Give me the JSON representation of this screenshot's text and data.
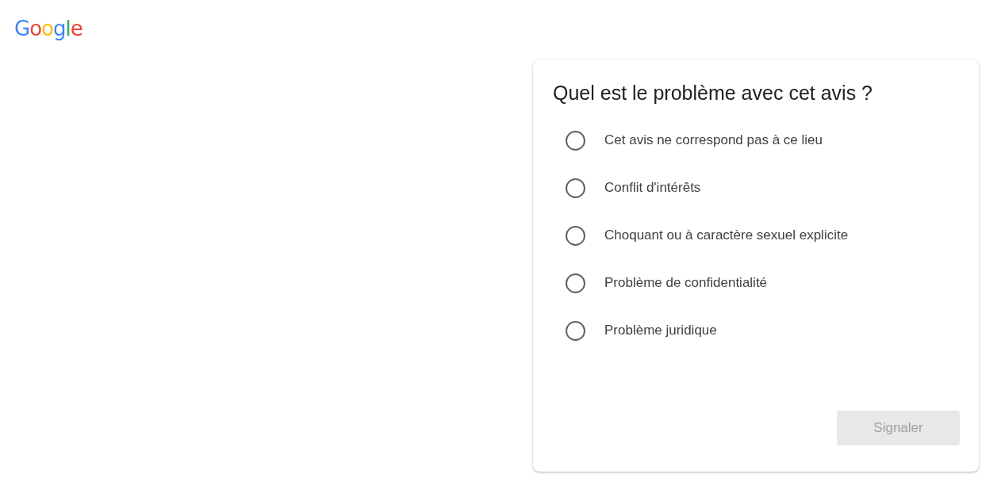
{
  "logo": "Google",
  "dialog": {
    "title": "Quel est le problème avec cet avis ?",
    "options": [
      {
        "label": "Cet avis ne correspond pas à ce lieu",
        "selected": false
      },
      {
        "label": "Conflit d'intérêts",
        "selected": false
      },
      {
        "label": "Choquant ou à caractère sexuel explicite",
        "selected": false
      },
      {
        "label": "Problème de confidentialité",
        "selected": false
      },
      {
        "label": "Problème juridique",
        "selected": false
      }
    ],
    "submit": {
      "label": "Signaler",
      "disabled": true
    }
  }
}
